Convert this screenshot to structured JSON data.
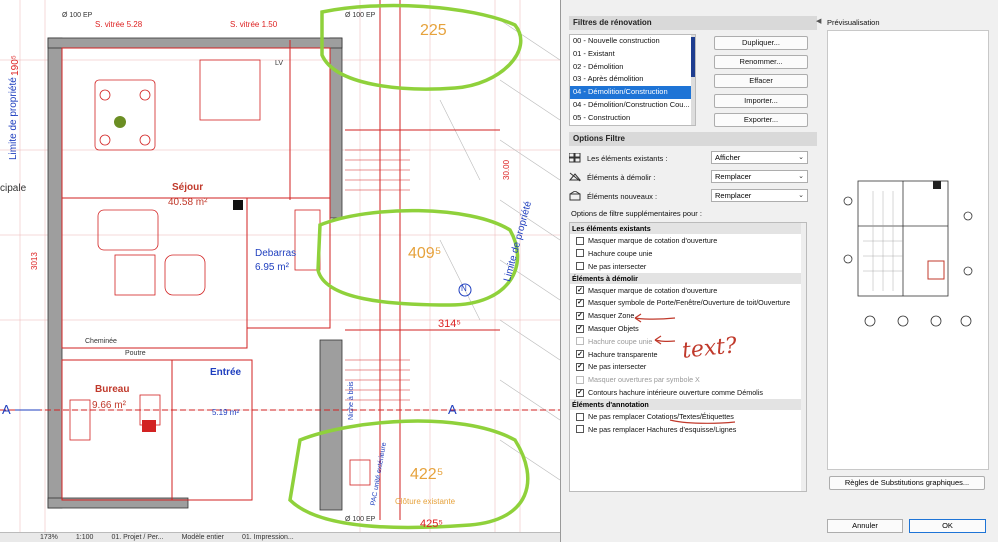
{
  "plan": {
    "level_tag": "Ø 100 EP",
    "vitree_a": "S. vitrée 5.28",
    "vitree_b": "S. vitrée 1.50",
    "dim_190": "190⁵",
    "dim_225": "225",
    "dim_409": "409⁵",
    "dim_422": "422⁵",
    "dim_314": "314⁵",
    "dim_425": "425⁵",
    "dim_3013": "3013",
    "dim_3000": "30.00",
    "limite_left": "Limite de propriété",
    "limite_right": "Limite de propriété",
    "cipale": "cipale",
    "sejour_name": "Séjour",
    "sejour_area": "40.58 m²",
    "debarras_name": "Debarras",
    "debarras_area": "6.95 m²",
    "bureau_name": "Bureau",
    "bureau_area": "9.66 m²",
    "entree_name": "Entrée",
    "entree_area": "5.19 m²",
    "cheminee": "Cheminée",
    "poutre": "Poutre",
    "lv": "LV",
    "niche_bois": "Niche à bois",
    "pac": "PAC unité extérieure",
    "clot_exist": "Clôture existante",
    "section_a": "A",
    "north": "N",
    "status_zoom": "173%",
    "status_scale": "1:100",
    "status_project": "01. Projet / Per...",
    "status_model": "Modèle entier",
    "status_impression": "01. Impression..."
  },
  "dialog": {
    "reno_header": "Filtres de rénovation",
    "reno_items": [
      "00 - Nouvelle construction",
      "01 - Existant",
      "02 - Démolition",
      "03 - Après démolition",
      "04 - Démolition/Construction",
      "04 - Démolition/Construction Cou...",
      "05 - Construction"
    ],
    "reno_selected": 4,
    "buttons": {
      "duplicate": "Dupliquer...",
      "rename": "Renommer...",
      "delete": "Effacer",
      "import": "Importer...",
      "export": "Exporter..."
    },
    "options_header": "Options Filtre",
    "opt_existing_label": "Les éléments existants :",
    "opt_existing_value": "Afficher",
    "opt_demolish_label": "Éléments à démolir :",
    "opt_demolish_value": "Remplacer",
    "opt_new_label": "Éléments nouveaux :",
    "opt_new_value": "Remplacer",
    "extra_options_label": "Options de filtre supplémentaires pour :",
    "groups": [
      {
        "title": "Les éléments existants",
        "items": [
          {
            "label": "Masquer marque de cotation d'ouverture",
            "checked": false,
            "disabled": false
          },
          {
            "label": "Hachure coupe unie",
            "checked": false,
            "disabled": false
          },
          {
            "label": "Ne pas intersecter",
            "checked": false,
            "disabled": false
          }
        ]
      },
      {
        "title": "Éléments à démolir",
        "items": [
          {
            "label": "Masquer marque de cotation d'ouverture",
            "checked": true,
            "disabled": false
          },
          {
            "label": "Masquer symbole de Porte/Fenêtre/Ouverture de toit/Ouverture",
            "checked": true,
            "disabled": false
          },
          {
            "label": "Masquer Zone",
            "checked": true,
            "disabled": false
          },
          {
            "label": "Masquer Objets",
            "checked": true,
            "disabled": false
          },
          {
            "label": "Hachure coupe unie",
            "checked": false,
            "disabled": true
          },
          {
            "label": "Hachure transparente",
            "checked": true,
            "disabled": false
          },
          {
            "label": "Ne pas intersecter",
            "checked": true,
            "disabled": false
          },
          {
            "label": "Masquer ouvertures par symbole X",
            "checked": false,
            "disabled": true
          },
          {
            "label": "Contours hachure intérieure ouverture comme Démolis",
            "checked": true,
            "disabled": false
          }
        ]
      },
      {
        "title": "Éléments d'annotation",
        "items": [
          {
            "label": "Ne pas remplacer Cotations/Textes/Étiquettes",
            "checked": false,
            "disabled": false
          },
          {
            "label": "Ne pas remplacer Hachures d'esquisse/Lignes",
            "checked": false,
            "disabled": false
          }
        ]
      }
    ],
    "preview_label": "Prévisualisation",
    "substitution_button": "Règles de Substitutions graphiques...",
    "cancel": "Annuler",
    "ok": "OK"
  },
  "annotation": {
    "handwritten": "text?"
  },
  "colors": {
    "accent": "#1e74d6",
    "highlight": "#8fd13b",
    "plan_red": "#d22222"
  }
}
